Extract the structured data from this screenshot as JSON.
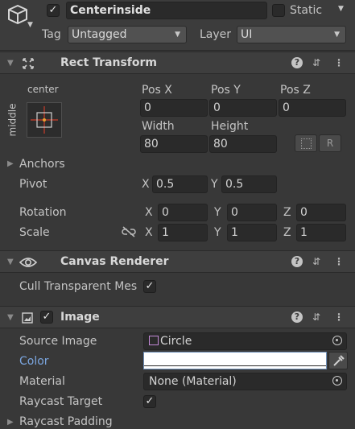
{
  "object": {
    "name": "Centerinside",
    "active": true,
    "static_label": "Static",
    "static": false,
    "tag_label": "Tag",
    "tag_value": "Untagged",
    "layer_label": "Layer",
    "layer_value": "UI"
  },
  "rect_transform": {
    "title": "Rect Transform",
    "anchor_h": "center",
    "anchor_v": "middle",
    "pos_x_label": "Pos X",
    "pos_x": "0",
    "pos_y_label": "Pos Y",
    "pos_y": "0",
    "pos_z_label": "Pos Z",
    "pos_z": "0",
    "width_label": "Width",
    "width": "80",
    "height_label": "Height",
    "height": "80",
    "raw_btn": "R",
    "anchors_label": "Anchors",
    "pivot_label": "Pivot",
    "pivot_x_label": "X",
    "pivot_x": "0.5",
    "pivot_y_label": "Y",
    "pivot_y": "0.5",
    "rotation_label": "Rotation",
    "rot_x": "0",
    "rot_y": "0",
    "rot_z": "0",
    "scale_label": "Scale",
    "scale_x": "1",
    "scale_y": "1",
    "scale_z": "1",
    "x_label": "X",
    "y_label": "Y",
    "z_label": "Z"
  },
  "canvas_renderer": {
    "title": "Canvas Renderer",
    "cull_label": "Cull Transparent Mes",
    "cull": true
  },
  "image": {
    "title": "Image",
    "enabled": true,
    "source_label": "Source Image",
    "source_value": "Circle",
    "color_label": "Color",
    "color_value": "#ffffff",
    "material_label": "Material",
    "material_value": "None (Material)",
    "raycast_label": "Raycast Target",
    "raycast": true,
    "raycast_padding_label": "Raycast Padding"
  },
  "colors": {
    "background": "#383838",
    "header": "#3e3e3e",
    "field": "#2a2a2a",
    "accent_label": "#7ba6e0"
  }
}
